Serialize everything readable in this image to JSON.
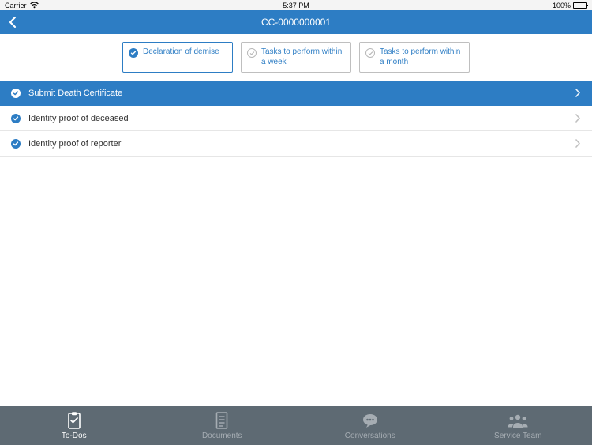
{
  "status_bar": {
    "carrier": "Carrier",
    "time": "5:37 PM",
    "battery_pct": "100%"
  },
  "nav": {
    "title": "CC-0000000001"
  },
  "tabs": [
    {
      "label": "Declaration of demise",
      "state": "done"
    },
    {
      "label": "Tasks to perform within a week",
      "state": "pending"
    },
    {
      "label": "Tasks to perform within a month",
      "state": "pending"
    }
  ],
  "list": [
    {
      "label": "Submit Death Certificate",
      "active": true
    },
    {
      "label": "Identity proof of deceased",
      "active": false
    },
    {
      "label": "Identity proof of reporter",
      "active": false
    }
  ],
  "bottom_nav": [
    {
      "label": "To-Dos",
      "active": true
    },
    {
      "label": "Documents",
      "active": false
    },
    {
      "label": "Conversations",
      "active": false
    },
    {
      "label": "Service Team",
      "active": false
    }
  ]
}
